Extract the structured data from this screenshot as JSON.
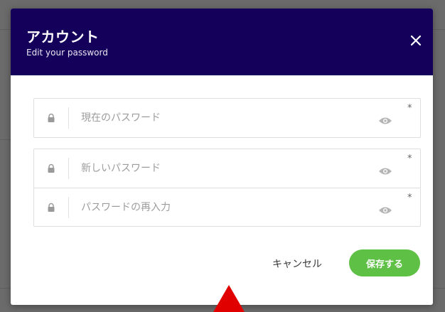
{
  "modal": {
    "title": "アカウント",
    "subtitle": "Edit your password",
    "close_icon": "close-icon",
    "header_color": "#14005a"
  },
  "fields": {
    "current_password": {
      "placeholder": "現在のパスワード",
      "value": "",
      "required_mark": "*",
      "icons": [
        "lock-icon",
        "eye-icon"
      ]
    },
    "new_password": {
      "placeholder": "新しいパスワード",
      "value": "",
      "required_mark": "*",
      "icons": [
        "lock-icon",
        "eye-icon"
      ]
    },
    "confirm_password": {
      "placeholder": "パスワードの再入力",
      "value": "",
      "required_mark": "*",
      "icons": [
        "lock-icon",
        "eye-icon"
      ]
    }
  },
  "actions": {
    "cancel_label": "キャンセル",
    "save_label": "保存する",
    "save_color": "#5ec145"
  },
  "cursor": {
    "icon": "red-arrow-cursor-icon",
    "color": "#e10000"
  }
}
